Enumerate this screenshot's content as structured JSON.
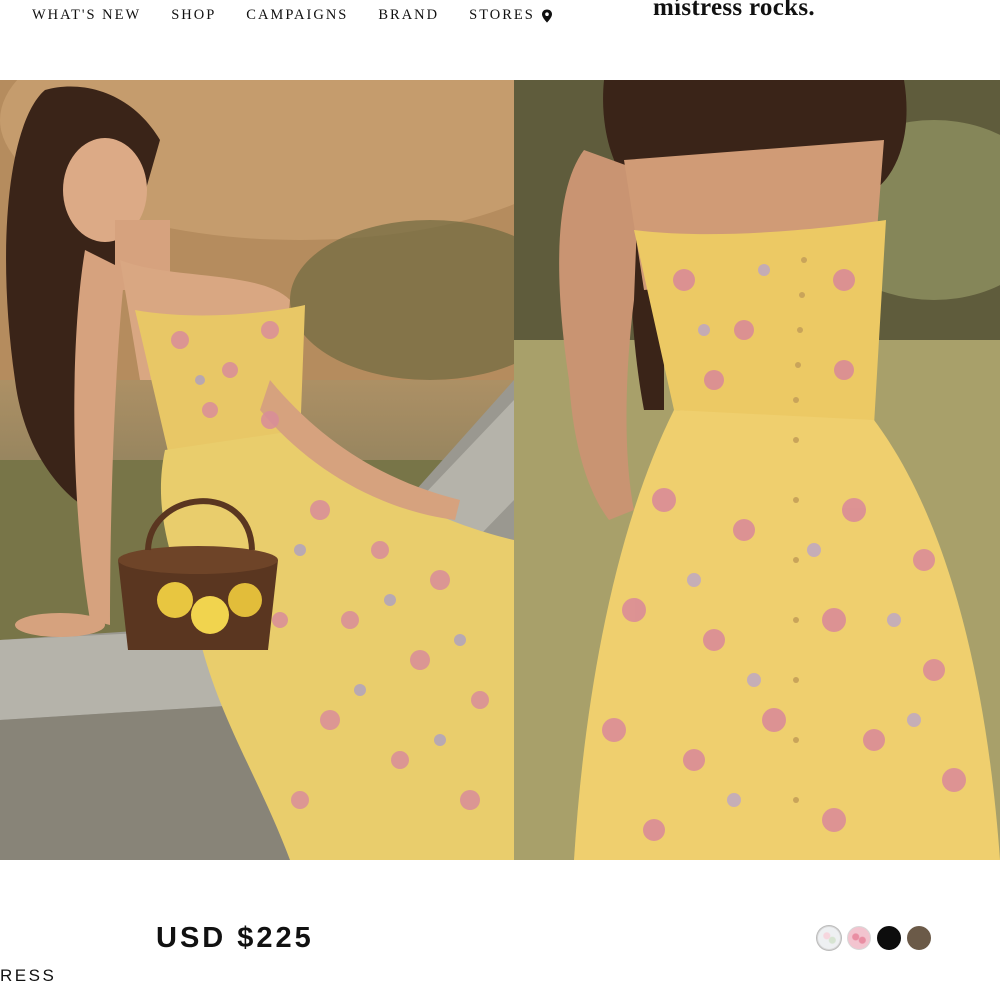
{
  "header": {
    "nav": [
      {
        "label": "WHAT'S NEW"
      },
      {
        "label": "SHOP"
      },
      {
        "label": "CAMPAIGNS"
      },
      {
        "label": "BRAND"
      },
      {
        "label": "STORES",
        "icon": "location-pin-icon"
      }
    ],
    "logo": "místress rocks."
  },
  "gallery": {
    "images": [
      {
        "alt": "model seated on stone wall in yellow floral dress with basket of lemons",
        "icon": "product-photo"
      },
      {
        "alt": "close-up of yellow floral button-front midi dress",
        "icon": "product-photo"
      }
    ]
  },
  "product": {
    "price": "USD $225",
    "name_fragment": "RESS",
    "swatches": [
      {
        "name": "white floral",
        "color": "#eef0f2",
        "selected": true
      },
      {
        "name": "pink floral",
        "color": "#f2c4cf"
      },
      {
        "name": "black",
        "color": "#0d0d0d"
      },
      {
        "name": "brown",
        "color": "#6b5a48"
      }
    ]
  },
  "colors": {
    "text": "#111111",
    "background": "#ffffff"
  }
}
